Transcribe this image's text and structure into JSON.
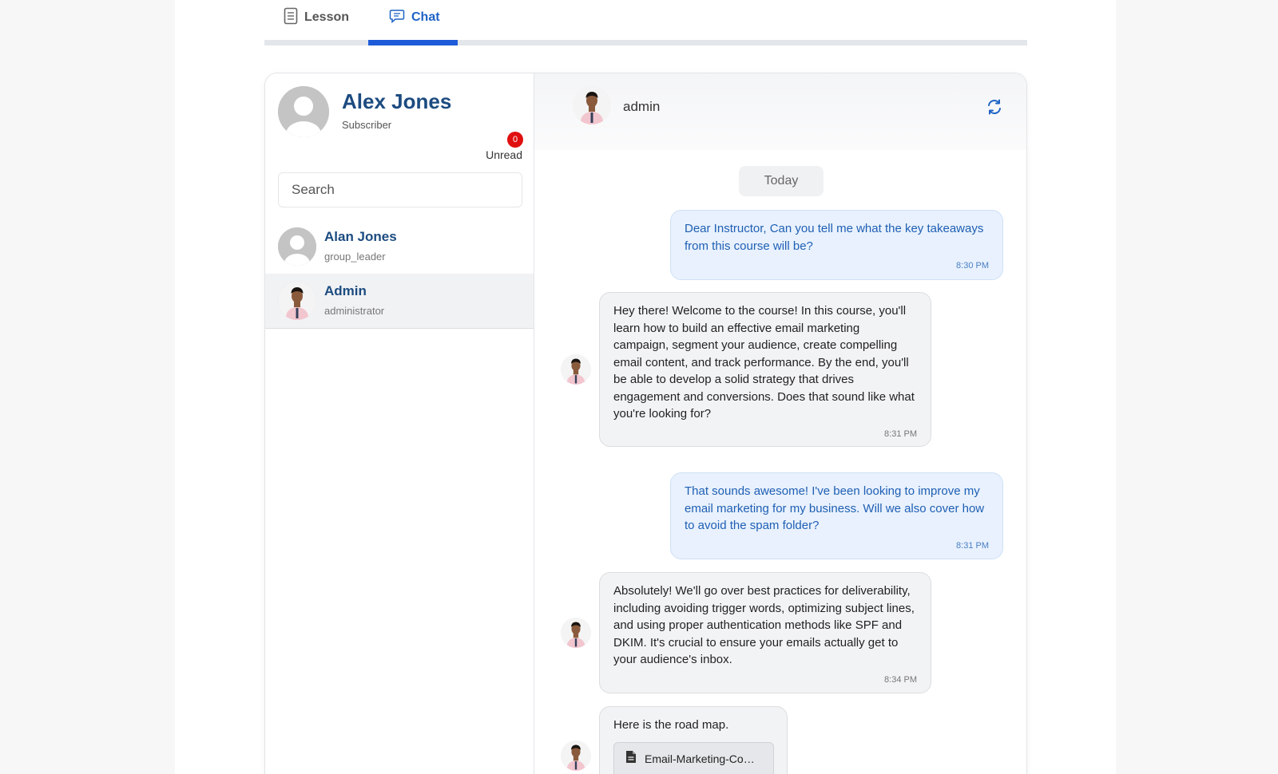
{
  "tabs": [
    {
      "label": "Lesson",
      "icon": "document-icon",
      "active": false
    },
    {
      "label": "Chat",
      "icon": "chat-bubble-icon",
      "active": true
    }
  ],
  "colors": {
    "accent": "#1e5bd8",
    "name": "#1c4b80",
    "badge": "#e01010"
  },
  "profile": {
    "name": "Alex Jones",
    "role": "Subscriber",
    "unread_count": "0",
    "unread_label": "Unread"
  },
  "search": {
    "placeholder": "Search",
    "value": ""
  },
  "contacts": [
    {
      "name": "Alan Jones",
      "role": "group_leader",
      "avatar": "default-avatar"
    },
    {
      "name": "Admin",
      "role": "administrator",
      "avatar": "photo-avatar",
      "active": true
    }
  ],
  "conversation": {
    "header_name": "admin",
    "day_label": "Today",
    "messages": [
      {
        "direction": "out",
        "text": "Dear Instructor, Can you tell me what the key takeaways from this course will be?",
        "time": "8:30 PM"
      },
      {
        "direction": "in",
        "text": "Hey there! Welcome to the course! In this course, you'll learn how to build an effective email marketing campaign, segment your audience, create compelling email content, and track performance. By the end, you'll be able to develop a solid strategy that drives engagement and conversions. Does that sound like what you're looking for?",
        "time": "8:31 PM"
      },
      {
        "direction": "out",
        "text": "That sounds awesome! I've been looking to improve my email marketing for my business. Will we also cover how to avoid the spam folder?",
        "time": "8:31 PM"
      },
      {
        "direction": "in",
        "text": "Absolutely! We'll go over best practices for deliverability, including avoiding trigger words, optimizing subject lines, and using proper authentication methods like SPF and DKIM. It's crucial to ensure your emails actually get to your audience's inbox.",
        "time": "8:34 PM"
      },
      {
        "direction": "in",
        "text": "Here is the road map.",
        "attachment": "Email-Marketing-Co…"
      }
    ]
  }
}
